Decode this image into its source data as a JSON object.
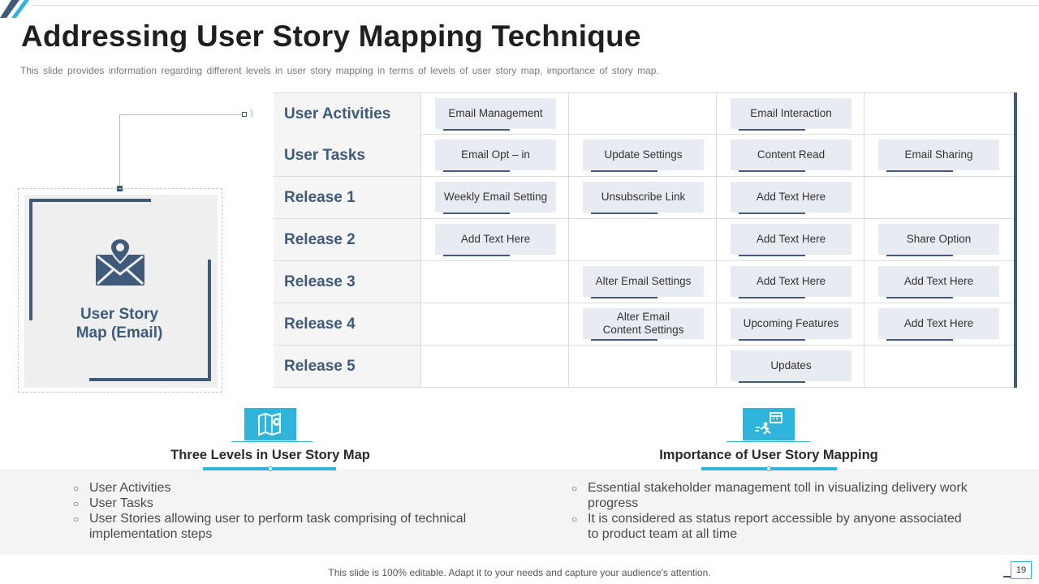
{
  "slide": {
    "title": "Addressing User Story Mapping Technique",
    "subtitle": "This slide provides information regarding different levels in user story mapping in terms of levels of user story map, importance of story map.",
    "footer": "This slide is 100% editable. Adapt it to your needs and capture your audience's attention.",
    "page_number": "19"
  },
  "card": {
    "label_line1": "User Story",
    "label_line2": "Map (Email)"
  },
  "grid": {
    "rows": [
      {
        "label": "User Activities",
        "cells": [
          "Email Management",
          "",
          "Email Interaction",
          ""
        ]
      },
      {
        "label": "User Tasks",
        "cells": [
          "Email Opt – in",
          "Update Settings",
          "Content Read",
          "Email Sharing"
        ]
      },
      {
        "label": "Release 1",
        "cells": [
          "Weekly Email Setting",
          "Unsubscribe Link",
          "Add Text Here",
          ""
        ]
      },
      {
        "label": "Release 2",
        "cells": [
          "Add Text Here",
          "",
          "Add Text Here",
          "Share Option"
        ]
      },
      {
        "label": "Release 3",
        "cells": [
          "",
          "Alter Email Settings",
          "Add Text Here",
          "Add Text Here"
        ]
      },
      {
        "label": "Release 4",
        "cells": [
          "",
          "Alter Email\nContent Settings",
          "Upcoming Features",
          "Add Text Here"
        ]
      },
      {
        "label": "Release 5",
        "cells": [
          "",
          "",
          "Updates",
          ""
        ]
      }
    ]
  },
  "sections": {
    "levels": {
      "title": "Three Levels in User Story Map",
      "icon": "map-pin-icon",
      "bullets": [
        "User Activities",
        "User Tasks",
        "User Stories allowing user to perform task comprising of technical implementation steps"
      ]
    },
    "importance": {
      "title": "Importance of User Story Mapping",
      "icon": "calendar-runner-icon",
      "bullets": [
        "Essential stakeholder management toll in visualizing delivery work progress",
        "It is considered as status report accessible by anyone associated to product team at all time"
      ]
    }
  },
  "colors": {
    "navy": "#3f5a7a",
    "accent": "#2fb5db",
    "chip": "#e8ecf2"
  }
}
